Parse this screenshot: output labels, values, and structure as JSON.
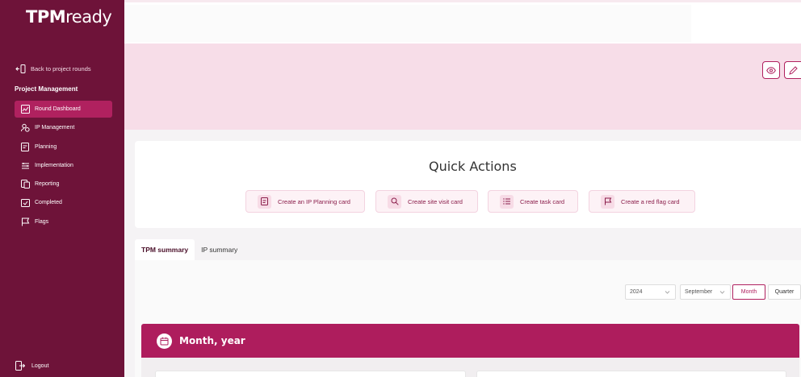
{
  "app": {
    "logo_bold": "TPM",
    "logo_rest": "ready"
  },
  "sidebar": {
    "back_label": "Back to project rounds",
    "section_title": "Project Management",
    "items": [
      {
        "label": "Round Dashboard",
        "icon": "dashboard-icon",
        "active": true
      },
      {
        "label": "IP Management",
        "icon": "users-icon"
      },
      {
        "label": "Planning",
        "icon": "planning-icon"
      },
      {
        "label": "Implementation",
        "icon": "implementation-icon"
      },
      {
        "label": "Reporting",
        "icon": "reporting-icon"
      },
      {
        "label": "Completed",
        "icon": "completed-icon"
      },
      {
        "label": "Flags",
        "icon": "flag-icon"
      }
    ],
    "logout_label": "Logout"
  },
  "banner": {
    "buttons": [
      "eye-icon",
      "edit-icon"
    ]
  },
  "quick_actions": {
    "title": "Quick Actions",
    "buttons": [
      {
        "label": "Create an IP Planning card",
        "icon": "planning-card-icon"
      },
      {
        "label": "Create site visit card",
        "icon": "site-visit-icon"
      },
      {
        "label": "Create task card",
        "icon": "task-list-icon"
      },
      {
        "label": "Create a red flag card",
        "icon": "red-flag-icon"
      }
    ]
  },
  "tabs": [
    {
      "label": "TPM summary",
      "active": true
    },
    {
      "label": "IP summary",
      "active": false
    }
  ],
  "filters": {
    "year": "2024",
    "month": "September",
    "period_options": [
      "Month",
      "Quarter"
    ],
    "period_selected": "Month"
  },
  "month_section": {
    "label": "Month, year"
  },
  "colors": {
    "sidebar": "#6e1339",
    "accent": "#b0215f",
    "banner": "#f7dde8"
  }
}
